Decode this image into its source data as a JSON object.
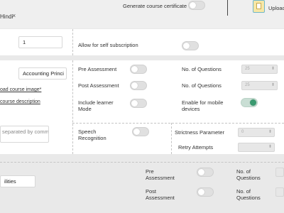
{
  "header": {
    "language": "Hindi",
    "remove_language": "×",
    "certificate_label": "Generate course certificate",
    "certificate_enabled": false,
    "upload_label": "Upload"
  },
  "settings": {
    "quantity_value": "1",
    "self_subscription_label": "Allow for self subscription",
    "self_subscription_enabled": false
  },
  "course": {
    "name_value": "Accounting Princi",
    "upload_image_link": "oad course image*",
    "description_link": "course description",
    "tags_placeholder": "separated by comma",
    "pre_assessment_label": "Pre Assessment",
    "post_assessment_label": "Post Assessment",
    "include_learner_mode_label": "Include learner Mode",
    "speech_recognition_label": "Speech Recognition",
    "questions_label_1": "No. of Questions",
    "questions_label_2": "No. of Questions",
    "questions_value_1": "25",
    "questions_value_2": "25",
    "mobile_devices_label": "Enable for mobile devices",
    "mobile_devices_enabled": true,
    "strictness_label": "Strictness Parameter",
    "strictness_value": "0",
    "retry_label": "Retry Attempts",
    "retry_value": ""
  },
  "lower": {
    "field_value": "ilities",
    "pre_assessment_label": "Pre Assessment",
    "post_assessment_label": "Post Assessment",
    "questions_label_1": "No. of Questions",
    "questions_label_2": "No. of Questions"
  },
  "colors": {
    "accent": "#3a9a70",
    "panel": "#ffffff",
    "background": "#e9e9e9"
  }
}
